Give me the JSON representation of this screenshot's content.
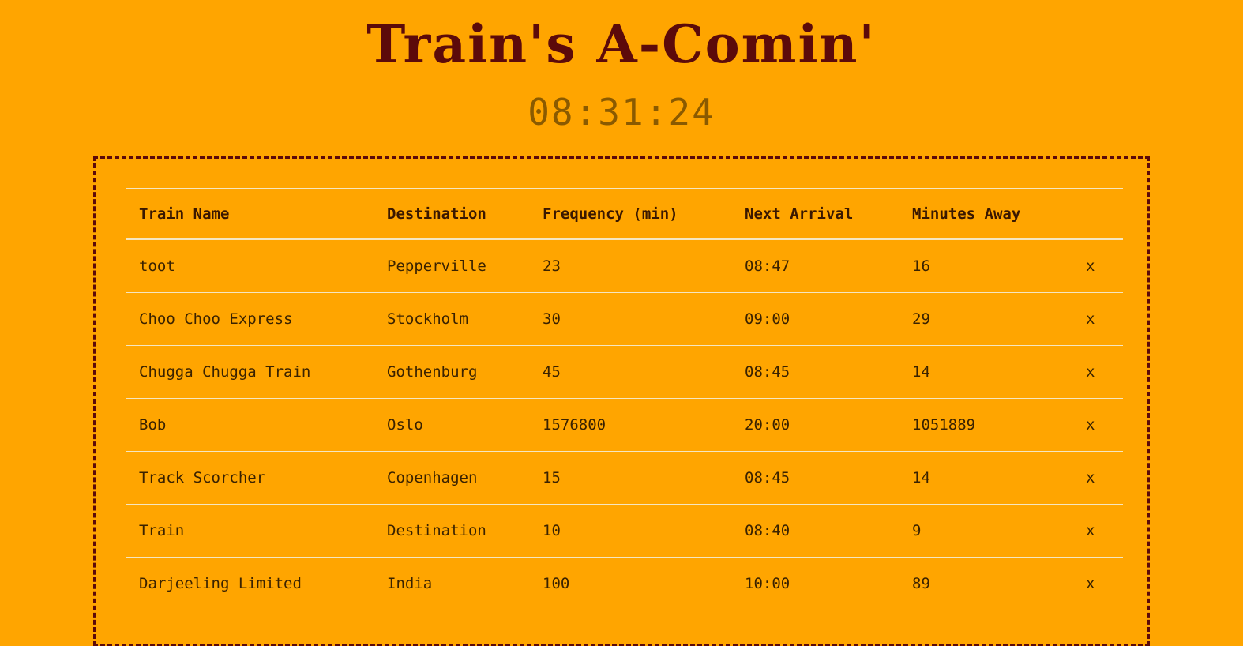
{
  "header": {
    "title": "Train's A-Comin'",
    "clock": "08:31:24"
  },
  "table": {
    "columns": {
      "name": "Train Name",
      "destination": "Destination",
      "frequency": "Frequency (min)",
      "next_arrival": "Next Arrival",
      "minutes_away": "Minutes Away"
    },
    "delete_label": "x",
    "rows": [
      {
        "name": "toot",
        "destination": "Pepperville",
        "frequency": "23",
        "next_arrival": "08:47",
        "minutes_away": "16"
      },
      {
        "name": "Choo Choo Express",
        "destination": "Stockholm",
        "frequency": "30",
        "next_arrival": "09:00",
        "minutes_away": "29"
      },
      {
        "name": "Chugga Chugga Train",
        "destination": "Gothenburg",
        "frequency": "45",
        "next_arrival": "08:45",
        "minutes_away": "14"
      },
      {
        "name": "Bob",
        "destination": "Oslo",
        "frequency": "1576800",
        "next_arrival": "20:00",
        "minutes_away": "1051889"
      },
      {
        "name": "Track Scorcher",
        "destination": "Copenhagen",
        "frequency": "15",
        "next_arrival": "08:45",
        "minutes_away": "14"
      },
      {
        "name": "Train",
        "destination": "Destination",
        "frequency": "10",
        "next_arrival": "08:40",
        "minutes_away": "9"
      },
      {
        "name": "Darjeeling Limited",
        "destination": "India",
        "frequency": "100",
        "next_arrival": "10:00",
        "minutes_away": "89"
      }
    ]
  },
  "colors": {
    "background": "#FFA500",
    "title": "#5c0a0a",
    "clock": "#8a5a00",
    "border": "#5c0a0a"
  }
}
